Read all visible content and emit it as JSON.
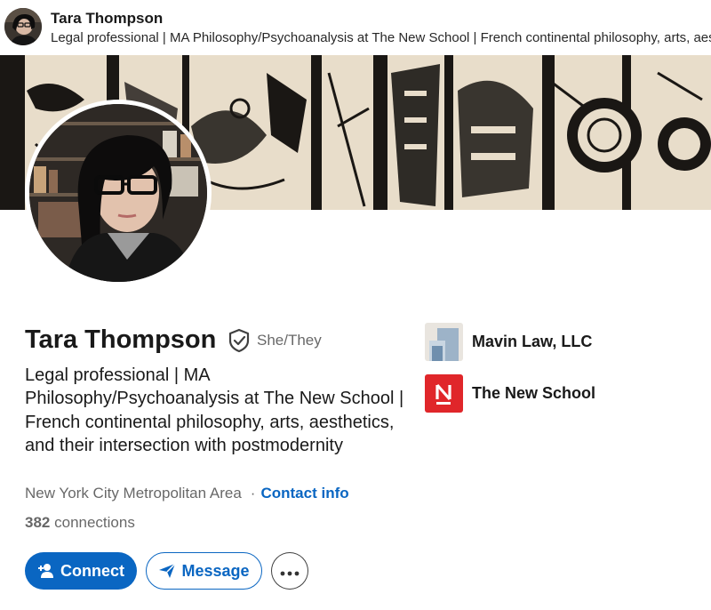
{
  "profile": {
    "name": "Tara Thompson",
    "pronouns": "She/They",
    "headline": "Legal professional | MA Philosophy/Psychoanalysis at The New School | French continental philosophy, arts, aesthetics, and their intersection with postmodernity",
    "location": "New York City Metropolitan Area",
    "separator": "·",
    "contact_label": "Contact info",
    "connections_count": "382",
    "connections_label": "connections"
  },
  "topbar": {
    "name": "Tara Thompson",
    "headline": "Legal professional | MA Philosophy/Psychoanalysis at The New School | French continental philosophy, arts, aesthetics, and their intersection with postmodernity"
  },
  "actions": {
    "connect_label": "Connect",
    "message_label": "Message",
    "more_icon": "ellipsis-icon"
  },
  "orgs": [
    {
      "name": "Mavin Law, LLC",
      "logo": "building-logo-icon"
    },
    {
      "name": "The New School",
      "logo": "new-school-logo-icon"
    }
  ],
  "colors": {
    "primary": "#0a66c2",
    "new_school_red": "#e0262a",
    "banner_bg": "#e8ddca"
  }
}
